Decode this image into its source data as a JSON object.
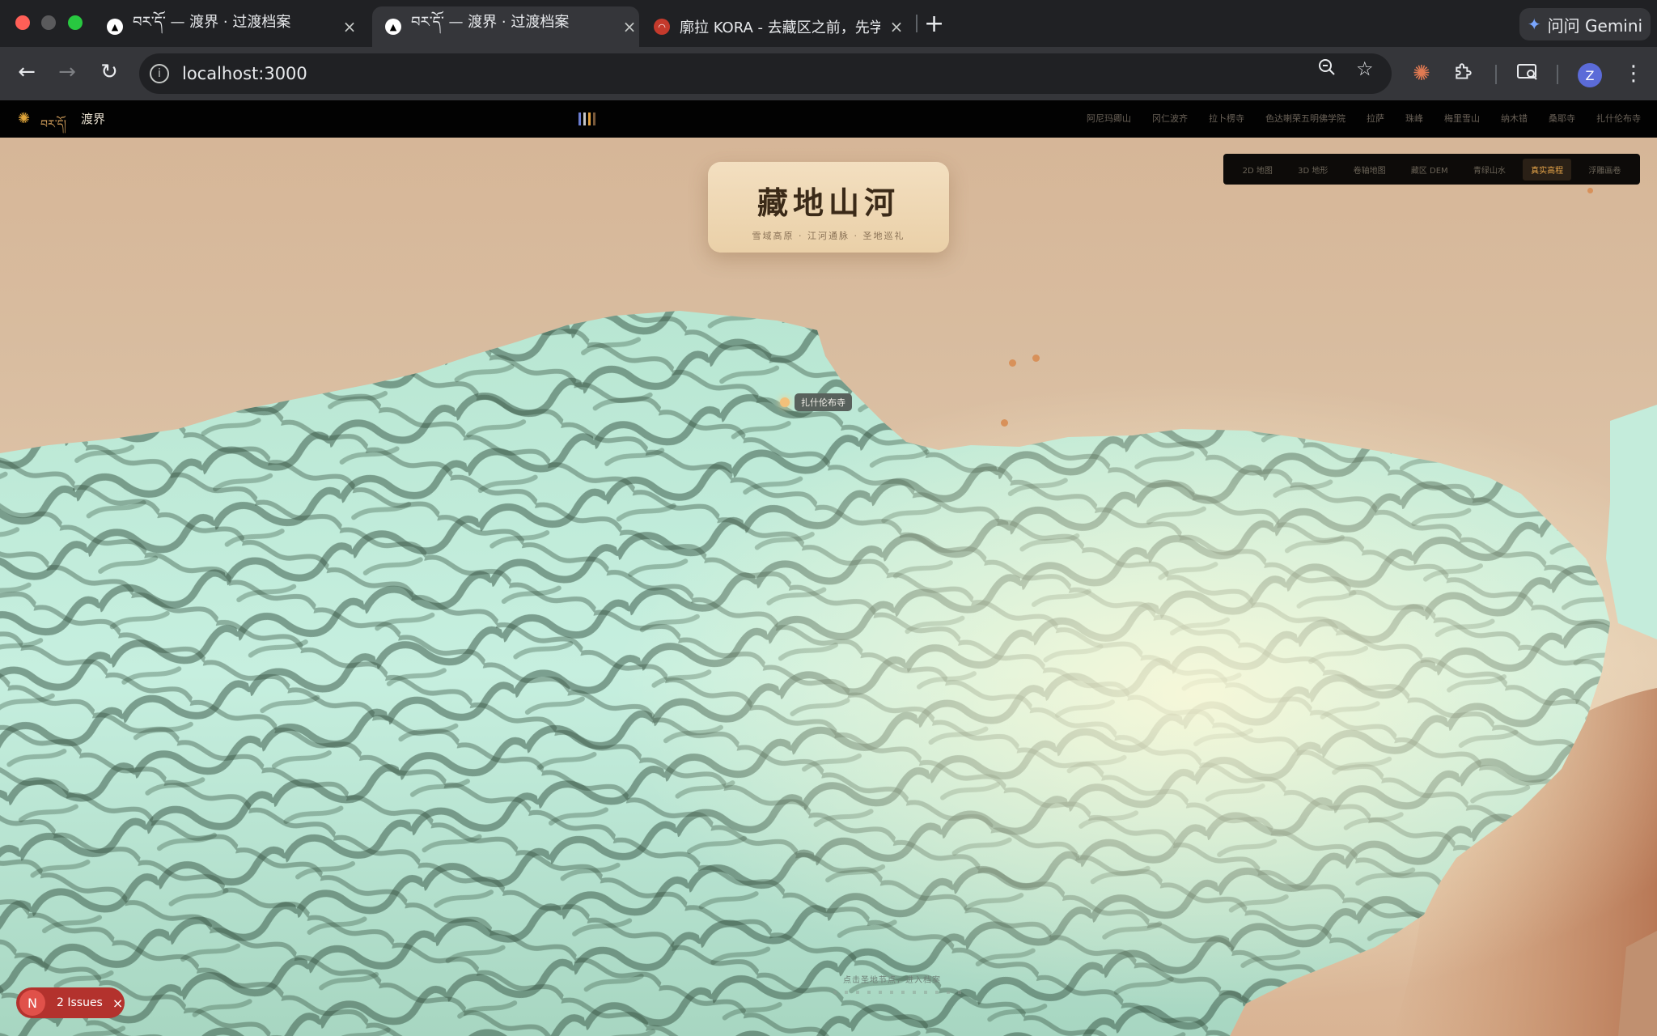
{
  "browser": {
    "tabs": [
      {
        "title": "བར་དོ་ — 渡界 · 过渡档案",
        "favicon": "▲"
      },
      {
        "title": "བར་དོ་ — 渡界 · 过渡档案",
        "favicon": "▲"
      },
      {
        "title": "廓拉 KORA - 去藏区之前，先学",
        "favicon": "◠"
      }
    ],
    "new_tab_label": "+",
    "gemini_label": "问问 Gemini",
    "url": "localhost:3000",
    "avatar_letter": "Z",
    "icons": {
      "back": "arrow-left-icon",
      "forward": "arrow-right-icon",
      "reload": "reload-icon",
      "info": "info-icon",
      "zoom": "zoom-icon",
      "bookmark": "star-icon",
      "extension": "puzzle-icon",
      "menu": "kebab-menu-icon"
    }
  },
  "site": {
    "logo_tibetan": "བར་དོ།",
    "logo_chinese": "渡界",
    "nav_links": [
      "阿尼玛卿山",
      "冈仁波齐",
      "拉卜楞寺",
      "色达喇荣五明佛学院",
      "拉萨",
      "珠峰",
      "梅里雪山",
      "纳木错",
      "桑耶寺",
      "扎什伦布寺"
    ],
    "title_card": {
      "title": "藏地山河",
      "subtitle": "雪域高原 · 江河通脉 · 圣地巡礼"
    },
    "view_modes": [
      "2D 地图",
      "3D 地形",
      "卷轴地图",
      "藏区 DEM",
      "青绿山水",
      "真实高程",
      "浮雕画卷"
    ],
    "active_view_mode": "真实高程",
    "marker_label": "扎什伦布寺",
    "hint": "点击圣地节点，进入档案",
    "issues_badge": {
      "letter": "N",
      "text": "2 Issues",
      "close": "×"
    }
  },
  "colors": {
    "header_bg": "#020202",
    "terrain_light": "#cdf0e0",
    "terrain_shadow": "#3c5a4a",
    "background": "#d8bc9f",
    "accent": "#e8a64a"
  }
}
